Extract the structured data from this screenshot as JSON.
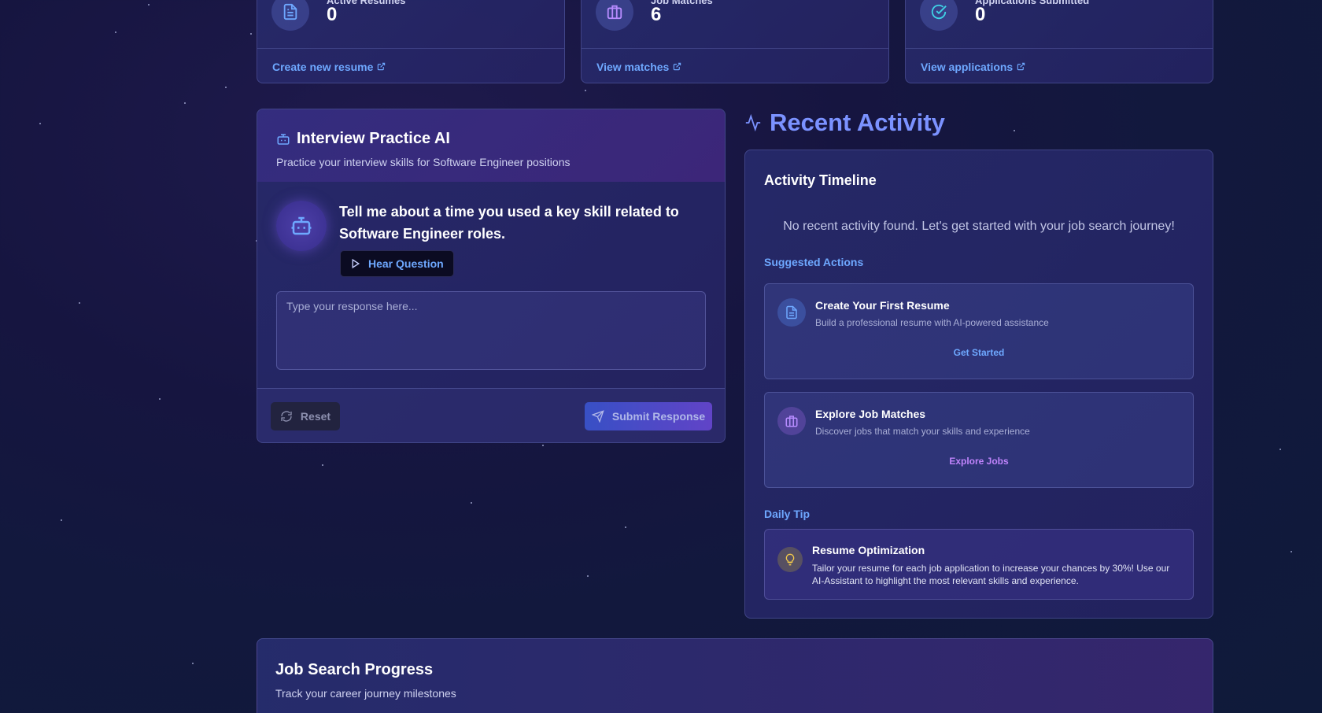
{
  "stats": [
    {
      "label": "Active Resumes",
      "value": "0",
      "link": "Create new resume"
    },
    {
      "label": "Job Matches",
      "value": "6",
      "link": "View matches"
    },
    {
      "label": "Applications Submitted",
      "value": "0",
      "link": "View applications"
    }
  ],
  "interview": {
    "title": "Interview Practice AI",
    "subtitle": "Practice your interview skills for Software Engineer positions",
    "question": "Tell me about a time you used a key skill related to Software Engineer roles.",
    "hear_button": "Hear Question",
    "response_placeholder": "Type your response here...",
    "reset_button": "Reset",
    "submit_button": "Submit Response"
  },
  "activity": {
    "section_title": "Recent Activity",
    "timeline_title": "Activity Timeline",
    "empty_message": "No recent activity found. Let's get started with your job search journey!",
    "suggested_label": "Suggested Actions",
    "suggestions": [
      {
        "title": "Create Your First Resume",
        "desc": "Build a professional resume with AI-powered assistance",
        "action": "Get Started",
        "icon": "document-icon",
        "color": "#6ea8ff"
      },
      {
        "title": "Explore Job Matches",
        "desc": "Discover jobs that match your skills and experience",
        "action": "Explore Jobs",
        "icon": "briefcase-icon",
        "color": "#b78cff"
      }
    ],
    "tip_label": "Daily Tip",
    "tip": {
      "title": "Resume Optimization",
      "desc": "Tailor your resume for each job application to increase your chances by 30%! Use our AI-Assistant to highlight the most relevant skills and experience.",
      "icon": "lightbulb-icon"
    }
  },
  "progress": {
    "title": "Job Search Progress",
    "subtitle": "Track your career journey milestones"
  }
}
